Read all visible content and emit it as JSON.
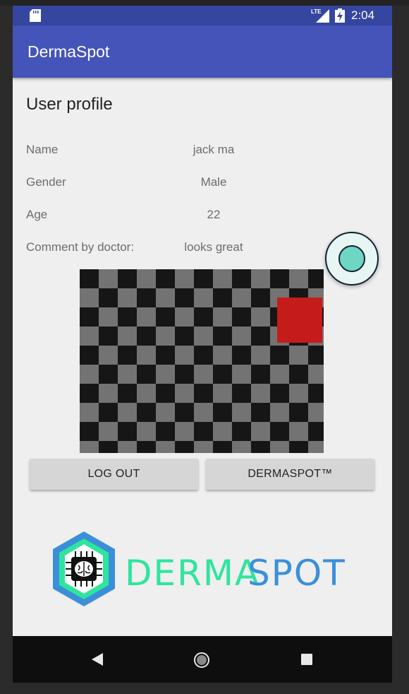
{
  "status_bar": {
    "time": "2:04",
    "network": "LTE",
    "icons": [
      "sd-card-icon",
      "lte-signal-icon",
      "battery-charging-icon"
    ]
  },
  "app_bar": {
    "title": "DermaSpot"
  },
  "profile": {
    "heading": "User profile",
    "rows": [
      {
        "label": "Name",
        "value": "jack ma"
      },
      {
        "label": "Gender",
        "value": "Male"
      },
      {
        "label": "Age",
        "value": "22"
      },
      {
        "label": "Comment by doctor:",
        "value": "looks great"
      }
    ]
  },
  "buttons": {
    "logout": "LOG OUT",
    "dermaspot": "DERMASPOT™"
  },
  "logo": {
    "text_left": "DERMA",
    "text_right": "SPOT"
  },
  "colors": {
    "status_bar": "#3546a0",
    "app_bar": "#4454b9",
    "background": "#efefef",
    "spot": "#c61b1b",
    "logo_green": "#2ee59d",
    "logo_blue": "#3b8fd9"
  }
}
